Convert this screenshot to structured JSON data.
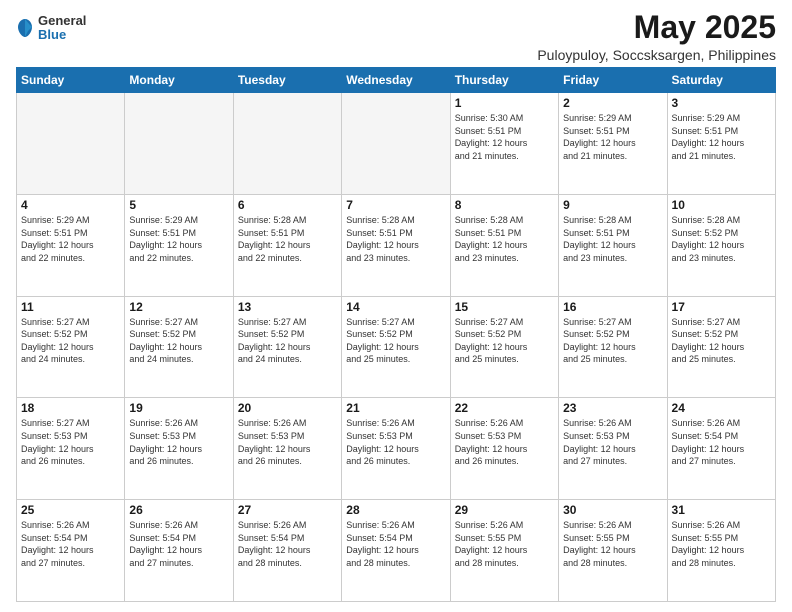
{
  "header": {
    "logo": {
      "general": "General",
      "blue": "Blue"
    },
    "title": "May 2025",
    "location": "Puloypuloy, Soccsksargen, Philippines"
  },
  "calendar": {
    "weekdays": [
      "Sunday",
      "Monday",
      "Tuesday",
      "Wednesday",
      "Thursday",
      "Friday",
      "Saturday"
    ],
    "weeks": [
      [
        {
          "day": "",
          "info": ""
        },
        {
          "day": "",
          "info": ""
        },
        {
          "day": "",
          "info": ""
        },
        {
          "day": "",
          "info": ""
        },
        {
          "day": "1",
          "info": "Sunrise: 5:30 AM\nSunset: 5:51 PM\nDaylight: 12 hours\nand 21 minutes."
        },
        {
          "day": "2",
          "info": "Sunrise: 5:29 AM\nSunset: 5:51 PM\nDaylight: 12 hours\nand 21 minutes."
        },
        {
          "day": "3",
          "info": "Sunrise: 5:29 AM\nSunset: 5:51 PM\nDaylight: 12 hours\nand 21 minutes."
        }
      ],
      [
        {
          "day": "4",
          "info": "Sunrise: 5:29 AM\nSunset: 5:51 PM\nDaylight: 12 hours\nand 22 minutes."
        },
        {
          "day": "5",
          "info": "Sunrise: 5:29 AM\nSunset: 5:51 PM\nDaylight: 12 hours\nand 22 minutes."
        },
        {
          "day": "6",
          "info": "Sunrise: 5:28 AM\nSunset: 5:51 PM\nDaylight: 12 hours\nand 22 minutes."
        },
        {
          "day": "7",
          "info": "Sunrise: 5:28 AM\nSunset: 5:51 PM\nDaylight: 12 hours\nand 23 minutes."
        },
        {
          "day": "8",
          "info": "Sunrise: 5:28 AM\nSunset: 5:51 PM\nDaylight: 12 hours\nand 23 minutes."
        },
        {
          "day": "9",
          "info": "Sunrise: 5:28 AM\nSunset: 5:51 PM\nDaylight: 12 hours\nand 23 minutes."
        },
        {
          "day": "10",
          "info": "Sunrise: 5:28 AM\nSunset: 5:52 PM\nDaylight: 12 hours\nand 23 minutes."
        }
      ],
      [
        {
          "day": "11",
          "info": "Sunrise: 5:27 AM\nSunset: 5:52 PM\nDaylight: 12 hours\nand 24 minutes."
        },
        {
          "day": "12",
          "info": "Sunrise: 5:27 AM\nSunset: 5:52 PM\nDaylight: 12 hours\nand 24 minutes."
        },
        {
          "day": "13",
          "info": "Sunrise: 5:27 AM\nSunset: 5:52 PM\nDaylight: 12 hours\nand 24 minutes."
        },
        {
          "day": "14",
          "info": "Sunrise: 5:27 AM\nSunset: 5:52 PM\nDaylight: 12 hours\nand 25 minutes."
        },
        {
          "day": "15",
          "info": "Sunrise: 5:27 AM\nSunset: 5:52 PM\nDaylight: 12 hours\nand 25 minutes."
        },
        {
          "day": "16",
          "info": "Sunrise: 5:27 AM\nSunset: 5:52 PM\nDaylight: 12 hours\nand 25 minutes."
        },
        {
          "day": "17",
          "info": "Sunrise: 5:27 AM\nSunset: 5:52 PM\nDaylight: 12 hours\nand 25 minutes."
        }
      ],
      [
        {
          "day": "18",
          "info": "Sunrise: 5:27 AM\nSunset: 5:53 PM\nDaylight: 12 hours\nand 26 minutes."
        },
        {
          "day": "19",
          "info": "Sunrise: 5:26 AM\nSunset: 5:53 PM\nDaylight: 12 hours\nand 26 minutes."
        },
        {
          "day": "20",
          "info": "Sunrise: 5:26 AM\nSunset: 5:53 PM\nDaylight: 12 hours\nand 26 minutes."
        },
        {
          "day": "21",
          "info": "Sunrise: 5:26 AM\nSunset: 5:53 PM\nDaylight: 12 hours\nand 26 minutes."
        },
        {
          "day": "22",
          "info": "Sunrise: 5:26 AM\nSunset: 5:53 PM\nDaylight: 12 hours\nand 26 minutes."
        },
        {
          "day": "23",
          "info": "Sunrise: 5:26 AM\nSunset: 5:53 PM\nDaylight: 12 hours\nand 27 minutes."
        },
        {
          "day": "24",
          "info": "Sunrise: 5:26 AM\nSunset: 5:54 PM\nDaylight: 12 hours\nand 27 minutes."
        }
      ],
      [
        {
          "day": "25",
          "info": "Sunrise: 5:26 AM\nSunset: 5:54 PM\nDaylight: 12 hours\nand 27 minutes."
        },
        {
          "day": "26",
          "info": "Sunrise: 5:26 AM\nSunset: 5:54 PM\nDaylight: 12 hours\nand 27 minutes."
        },
        {
          "day": "27",
          "info": "Sunrise: 5:26 AM\nSunset: 5:54 PM\nDaylight: 12 hours\nand 28 minutes."
        },
        {
          "day": "28",
          "info": "Sunrise: 5:26 AM\nSunset: 5:54 PM\nDaylight: 12 hours\nand 28 minutes."
        },
        {
          "day": "29",
          "info": "Sunrise: 5:26 AM\nSunset: 5:55 PM\nDaylight: 12 hours\nand 28 minutes."
        },
        {
          "day": "30",
          "info": "Sunrise: 5:26 AM\nSunset: 5:55 PM\nDaylight: 12 hours\nand 28 minutes."
        },
        {
          "day": "31",
          "info": "Sunrise: 5:26 AM\nSunset: 5:55 PM\nDaylight: 12 hours\nand 28 minutes."
        }
      ]
    ]
  }
}
